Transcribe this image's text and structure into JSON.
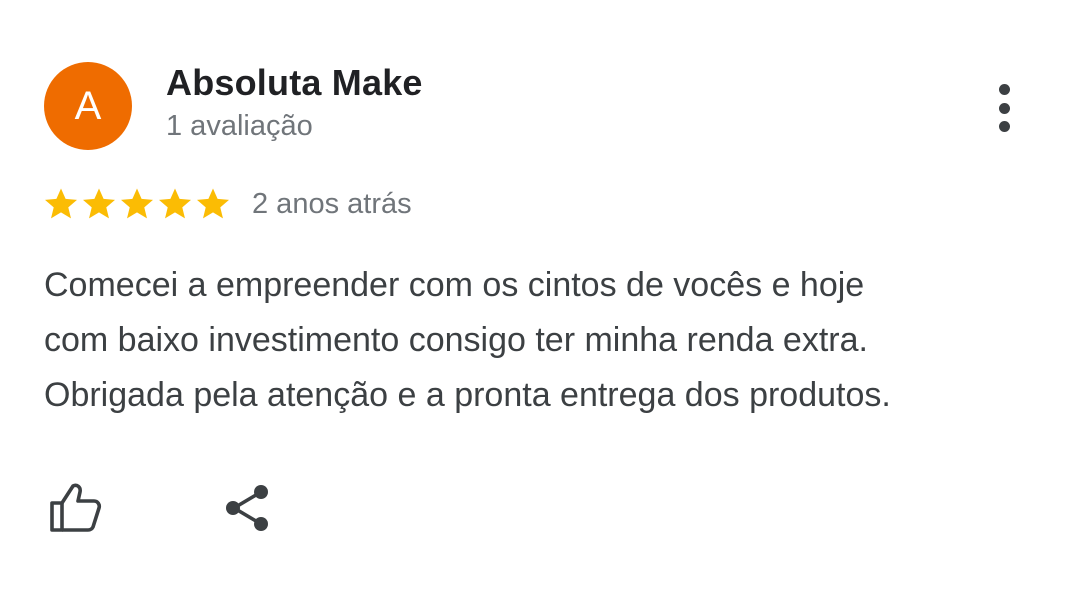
{
  "review": {
    "avatar_letter": "A",
    "avatar_color": "#ef6c00",
    "author_name": "Absoluta Make",
    "author_meta": "1 avaliação",
    "rating": 5,
    "rating_max": 5,
    "star_color": "#fbbc04",
    "time_ago": "2 anos atrás",
    "text": "Comecei a empreender com os cintos de vocês e hoje\ncom baixo investimento consigo ter minha renda extra.\nObrigada pela atenção e a pronta entrega dos produtos."
  },
  "icons": {
    "more": "more-vert-icon",
    "star": "star-icon",
    "like": "thumb-up-icon",
    "share": "share-icon"
  }
}
